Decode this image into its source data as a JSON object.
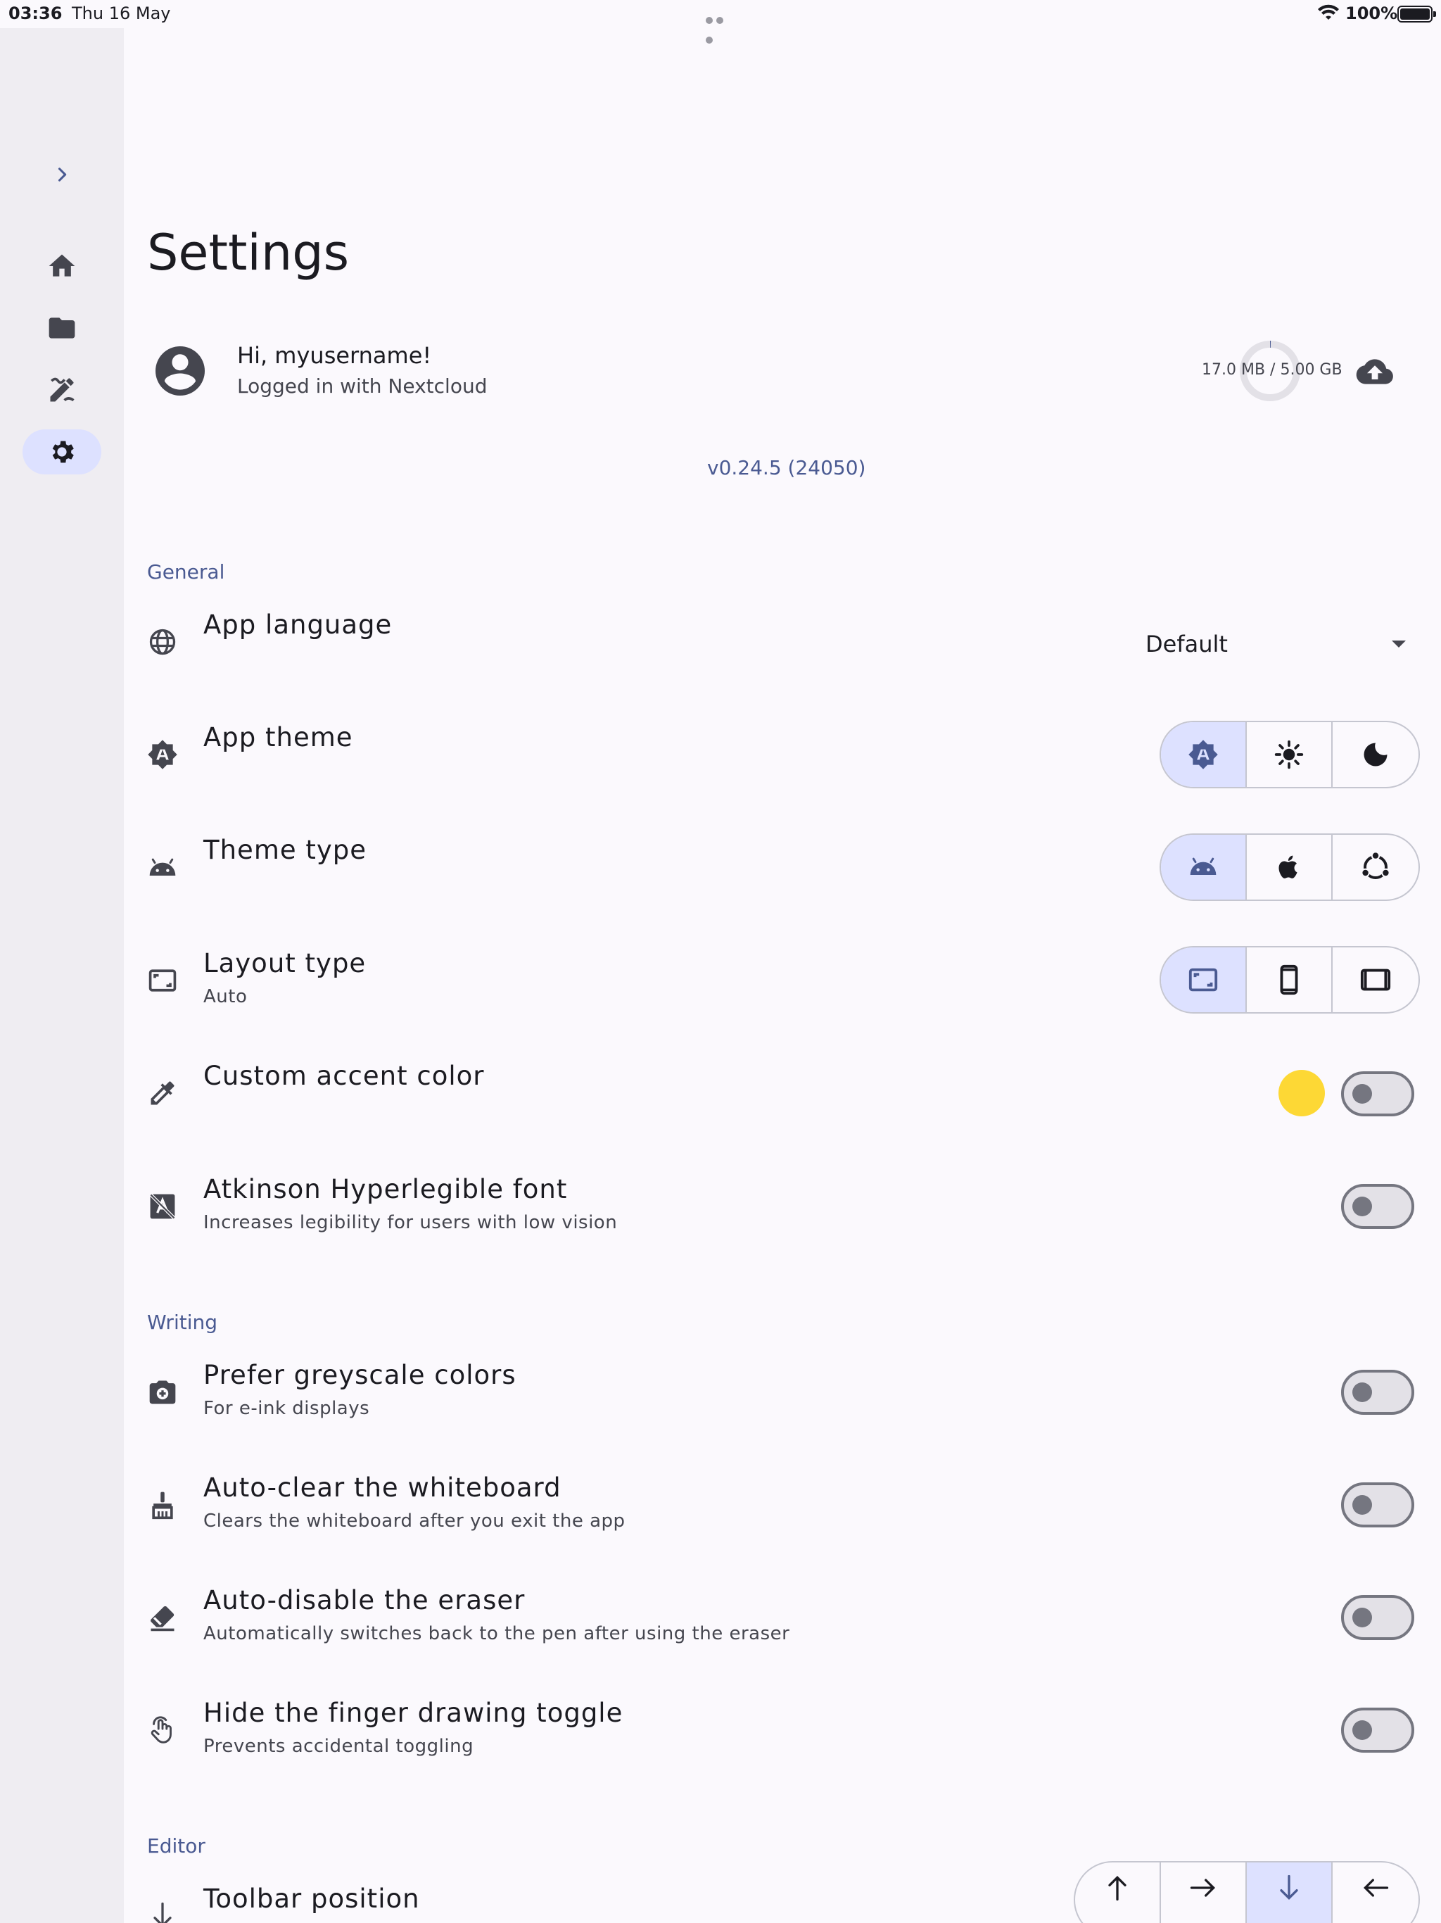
{
  "status_bar": {
    "time": "03:36",
    "date": "Thu 16 May",
    "battery": "100%"
  },
  "rail": {
    "items": [
      {
        "icon": "home-icon"
      },
      {
        "icon": "folder-icon"
      },
      {
        "icon": "draw-icon"
      },
      {
        "icon": "settings-icon",
        "active": true
      }
    ]
  },
  "page": {
    "title": "Settings"
  },
  "profile": {
    "greeting": "Hi, myusername!",
    "subtitle": "Logged in with Nextcloud",
    "storage": "17.0 MB / 5.00 GB",
    "storage_fraction": 0.0034
  },
  "version": "v0.24.5 (24050)",
  "sections": {
    "general": "General",
    "writing": "Writing",
    "editor": "Editor"
  },
  "settings": {
    "app_language": {
      "title": "App language",
      "value": "Default"
    },
    "app_theme": {
      "title": "App theme",
      "options": [
        "system-theme-icon",
        "light-mode-icon",
        "dark-mode-icon"
      ],
      "selected": 0
    },
    "theme_type": {
      "title": "Theme type",
      "options": [
        "android-icon",
        "apple-icon",
        "ubuntu-icon"
      ],
      "selected": 0
    },
    "layout_type": {
      "title": "Layout type",
      "subtitle": "Auto",
      "options": [
        "auto-layout-icon",
        "phone-layout-icon",
        "tablet-layout-icon"
      ],
      "selected": 0
    },
    "custom_accent": {
      "title": "Custom accent color",
      "color": "#fdd835",
      "enabled": false
    },
    "atkinson_font": {
      "title": "Atkinson Hyperlegible font",
      "subtitle": "Increases legibility for users with low vision",
      "enabled": false
    },
    "greyscale": {
      "title": "Prefer greyscale colors",
      "subtitle": "For e-ink displays",
      "enabled": false
    },
    "auto_clear": {
      "title": "Auto-clear the whiteboard",
      "subtitle": "Clears the whiteboard after you exit the app",
      "enabled": false
    },
    "auto_disable_eraser": {
      "title": "Auto-disable the eraser",
      "subtitle": "Automatically switches back to the pen after using the eraser",
      "enabled": false
    },
    "hide_finger_toggle": {
      "title": "Hide the finger drawing toggle",
      "subtitle": "Prevents accidental toggling",
      "enabled": false
    },
    "toolbar_position": {
      "title": "Toolbar position",
      "options": [
        "arrow-up-icon",
        "arrow-right-icon",
        "arrow-down-icon",
        "arrow-left-icon"
      ],
      "selected": 2
    }
  },
  "colors": {
    "accent": "#4a5a92",
    "selected_bg": "#dde1ff",
    "background": "#fbf9fd",
    "rail_bg": "#efedf2"
  }
}
